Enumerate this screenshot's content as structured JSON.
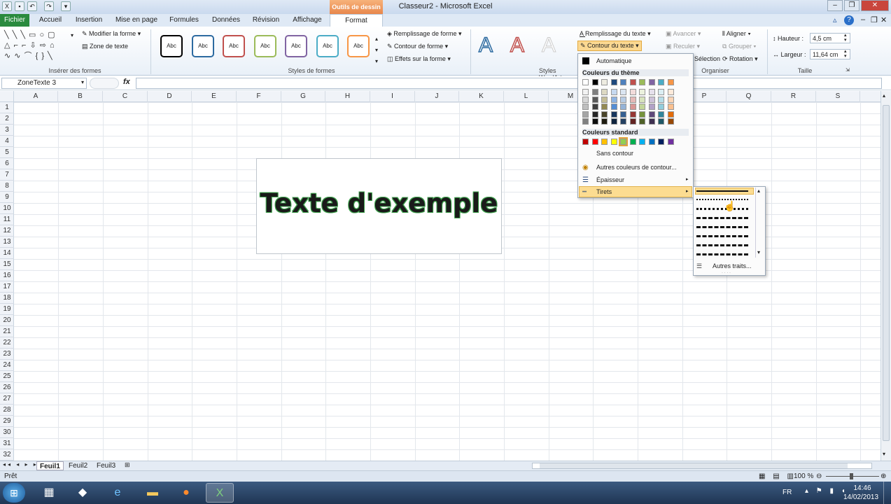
{
  "window": {
    "title": "Classeur2 - Microsoft Excel",
    "tools_label": "Outils de dessin"
  },
  "tabs": [
    "Fichier",
    "Accueil",
    "Insertion",
    "Mise en page",
    "Formules",
    "Données",
    "Révision",
    "Affichage",
    "Format"
  ],
  "ribbon": {
    "insert_shapes": {
      "label": "Insérer des formes",
      "modify_shape": "Modifier la forme",
      "text_zone": "Zone de texte"
    },
    "shape_styles": {
      "label": "Styles de formes",
      "style_text": "Abc",
      "fill": "Remplissage de forme",
      "outline": "Contour de forme",
      "effects": "Effets sur la forme"
    },
    "wordart": {
      "label": "Styles WordArt",
      "text_fill": "Remplissage du texte",
      "text_outline": "Contour du texte"
    },
    "organize": {
      "label": "Organiser",
      "forward": "Avancer",
      "backward": "Reculer",
      "selection": "Sélection",
      "align": "Aligner",
      "group": "Grouper",
      "rotation": "Rotation"
    },
    "size": {
      "label": "Taille",
      "height_label": "Hauteur :",
      "height_value": "4,5 cm",
      "width_label": "Largeur :",
      "width_value": "11,64 cm"
    }
  },
  "formula_bar": {
    "name_box": "ZoneTexte 3",
    "fx": "fx"
  },
  "columns": [
    "A",
    "B",
    "C",
    "D",
    "E",
    "F",
    "G",
    "H",
    "I",
    "J",
    "K",
    "L",
    "M",
    "N",
    "O",
    "P",
    "Q",
    "R",
    "S"
  ],
  "rows": [
    "1",
    "2",
    "3",
    "4",
    "5",
    "6",
    "7",
    "8",
    "9",
    "10",
    "11",
    "12",
    "13",
    "14",
    "15",
    "16",
    "17",
    "18",
    "19",
    "20",
    "21",
    "22",
    "23",
    "24",
    "25",
    "26",
    "27",
    "28",
    "29",
    "30",
    "31",
    "32"
  ],
  "textbox": {
    "text": "Texte d'exemple"
  },
  "outline_menu": {
    "automatic": "Automatique",
    "theme_colors_title": "Couleurs du thème",
    "theme_colors": [
      "#ffffff",
      "#000000",
      "#eeece1",
      "#1f497d",
      "#4f81bd",
      "#c0504d",
      "#9bbb59",
      "#8064a2",
      "#4bacc6",
      "#f79646"
    ],
    "theme_shade_columns": [
      [
        "#f2f2f2",
        "#d8d8d8",
        "#bfbfbf",
        "#a5a5a5",
        "#7f7f7f"
      ],
      [
        "#7f7f7f",
        "#595959",
        "#3f3f3f",
        "#262626",
        "#0c0c0c"
      ],
      [
        "#ddd9c3",
        "#c4bd97",
        "#938953",
        "#494429",
        "#1d1b10"
      ],
      [
        "#c6d9f0",
        "#8db3e2",
        "#548dd4",
        "#17365d",
        "#0f243e"
      ],
      [
        "#dbe5f1",
        "#b8cce4",
        "#95b3d7",
        "#366092",
        "#244061"
      ],
      [
        "#f2dcdb",
        "#e5b9b7",
        "#d99694",
        "#953734",
        "#632423"
      ],
      [
        "#ebf1dd",
        "#d7e3bc",
        "#c3d69b",
        "#76923c",
        "#4f6128"
      ],
      [
        "#e5e0ec",
        "#ccc1d9",
        "#b2a2c7",
        "#5f497a",
        "#3f3151"
      ],
      [
        "#dbeef3",
        "#b7dde8",
        "#92cddc",
        "#31859b",
        "#205867"
      ],
      [
        "#fdeada",
        "#fbd5b5",
        "#fac08f",
        "#e36c09",
        "#974806"
      ]
    ],
    "standard_colors_title": "Couleurs standard",
    "standard_colors": [
      "#c00000",
      "#ff0000",
      "#ffc000",
      "#ffff00",
      "#92d050",
      "#00b050",
      "#00b0f0",
      "#0070c0",
      "#002060",
      "#7030a0"
    ],
    "no_outline": "Sans contour",
    "more_colors": "Autres couleurs de contour...",
    "weight": "Épaisseur",
    "dashes": "Tirets"
  },
  "dash_menu": {
    "more_lines": "Autres traits..."
  },
  "sheets": [
    "Feuil1",
    "Feuil2",
    "Feuil3"
  ],
  "status": {
    "ready": "Prêt",
    "zoom": "100 %"
  },
  "taskbar": {
    "lang": "FR",
    "time": "14:46",
    "date": "14/02/2013"
  }
}
